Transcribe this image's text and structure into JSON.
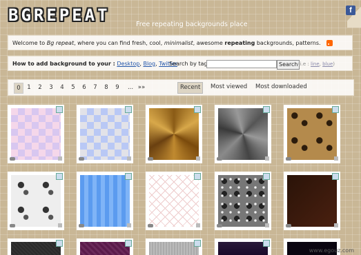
{
  "header": {
    "logo": "BGREPEAT",
    "tagline": "Free repeating backgrounds place",
    "fb_icon": "f"
  },
  "welcome": {
    "pre": "Welcome to ",
    "site": "Bg repeat",
    "mid1": ", where you can find fresh, cool, ",
    "em": "minimalist",
    "mid2": ", awesome ",
    "bold": "repeating",
    "post": " backgrounds, patterns.",
    "icon": "rss-icon"
  },
  "howto": {
    "label": "How to add background to your :",
    "links": [
      "Desktop",
      "Blog",
      "Twitter"
    ],
    "search_label": "Search by tag",
    "search_button": "Search",
    "hint_pre": "(i.e : ",
    "hint_links": [
      "line",
      "blue"
    ],
    "hint_post": ")"
  },
  "pager": {
    "pages": [
      "0",
      "1",
      "2",
      "3",
      "4",
      "5",
      "6",
      "7",
      "8",
      "9"
    ],
    "ellipsis": "...",
    "next": "»»",
    "sort": [
      "Recent",
      "Most viewed",
      "Most downloaded"
    ],
    "active_sort": "Recent",
    "active_page": "0"
  },
  "watermark": "www.egouz.com"
}
